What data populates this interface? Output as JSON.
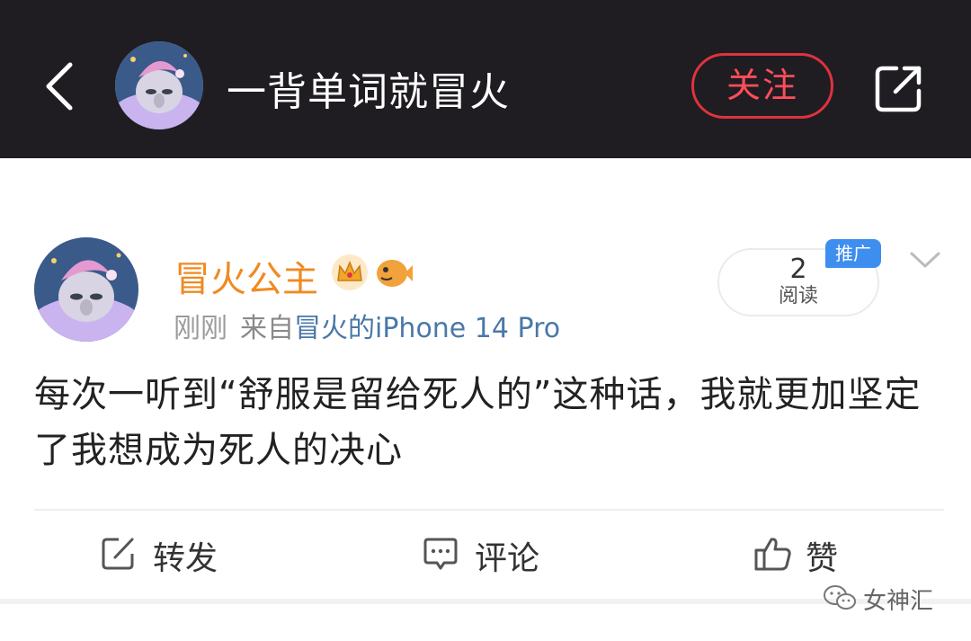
{
  "header": {
    "title": "一背单词就冒火",
    "follow_label": "关注"
  },
  "post": {
    "author": "冒火公主",
    "time": "刚刚",
    "source_prefix": "来自",
    "source_device": "冒火的iPhone 14 Pro",
    "read_count": "2",
    "read_label": "阅读",
    "promo_badge": "推广",
    "text": "每次一听到“舒服是留给死人的”这种话，我就更加坚定了我想成为死人的决心"
  },
  "actions": {
    "repost": "转发",
    "comment": "评论",
    "like": "赞"
  },
  "watermark": "女神汇",
  "icons": [
    "back-arrow-icon",
    "share-icon",
    "crown-icon",
    "fish-icon",
    "chevron-down-icon",
    "repost-icon",
    "comment-icon",
    "thumbs-up-icon",
    "wechat-icon"
  ],
  "colors": {
    "header_bg": "#1f1d22",
    "follow_red": "#e0323e",
    "username_orange": "#f08a22",
    "device_blue": "#4a78a8",
    "promo_blue": "#3e8ef0"
  }
}
